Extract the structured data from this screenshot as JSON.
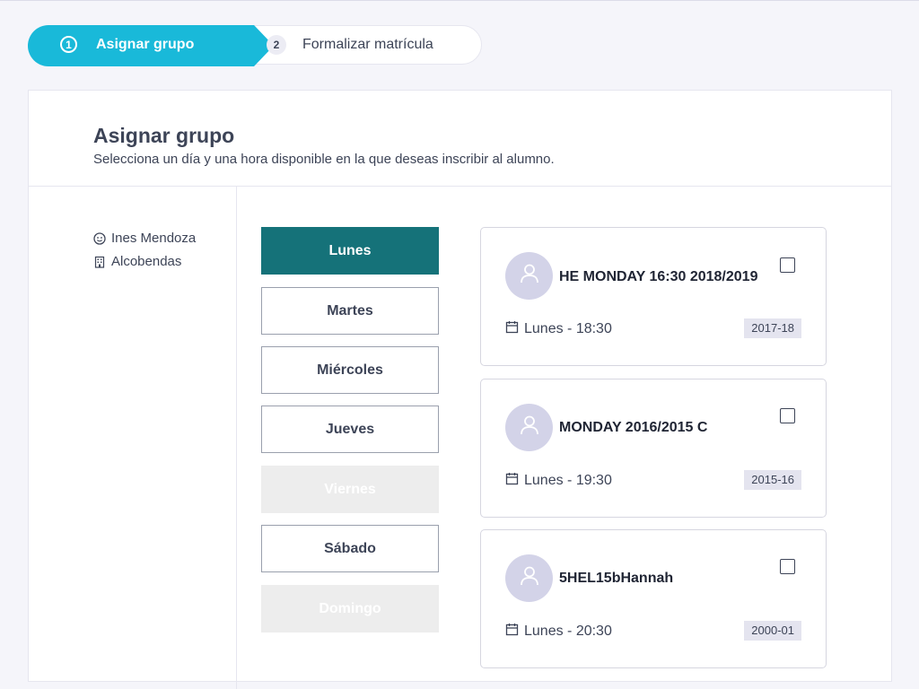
{
  "stepper": {
    "steps": [
      {
        "number": "1",
        "label": "Asignar grupo",
        "active": true
      },
      {
        "number": "2",
        "label": "Formalizar matrícula",
        "active": false
      }
    ]
  },
  "header": {
    "title": "Asignar grupo",
    "subtitle": "Selecciona un día y una hora disponible en la que deseas inscribir al alumno."
  },
  "student": {
    "name": "Ines Mendoza",
    "name_icon": "face-icon",
    "location": "Alcobendas",
    "location_icon": "building-icon"
  },
  "days": [
    {
      "label": "Lunes",
      "state": "selected"
    },
    {
      "label": "Martes",
      "state": "enabled"
    },
    {
      "label": "Miércoles",
      "state": "enabled"
    },
    {
      "label": "Jueves",
      "state": "enabled"
    },
    {
      "label": "Viernes",
      "state": "disabled"
    },
    {
      "label": "Sábado",
      "state": "enabled"
    },
    {
      "label": "Domingo",
      "state": "disabled"
    }
  ],
  "groups": [
    {
      "name": "HE MONDAY 16:30 2018/2019",
      "time": "Lunes - 18:30",
      "year": "2017-18",
      "checked": false
    },
    {
      "name": "MONDAY 2016/2015 C",
      "time": "Lunes - 19:30",
      "year": "2015-16",
      "checked": false
    },
    {
      "name": "5HEL15bHannah",
      "time": "Lunes - 20:30",
      "year": "2000-01",
      "checked": false
    }
  ],
  "colors": {
    "accent": "#19b9d9",
    "selected_day": "#157279",
    "disabled_day": "#ededed",
    "avatar_bg": "#d3d3e8",
    "badge_bg": "#e4e4ef"
  }
}
